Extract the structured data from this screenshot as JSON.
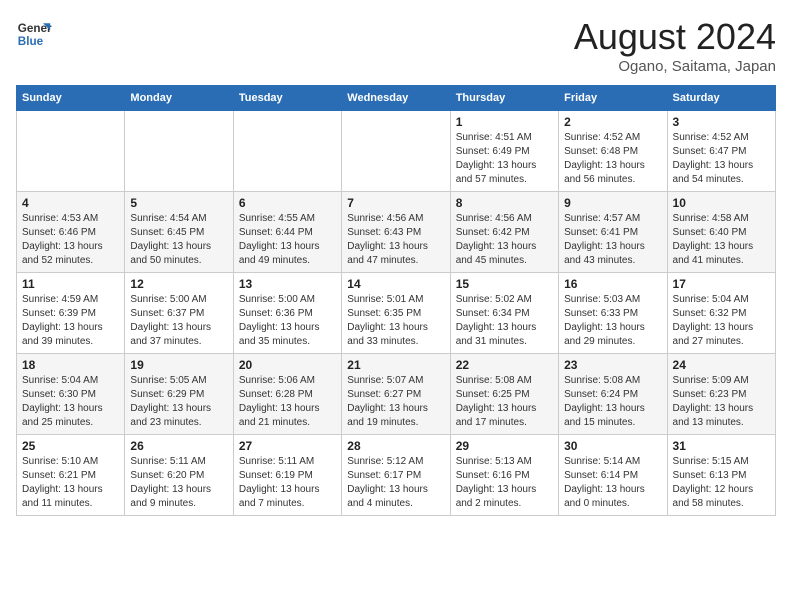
{
  "header": {
    "logo_line1": "General",
    "logo_line2": "Blue",
    "month": "August 2024",
    "location": "Ogano, Saitama, Japan"
  },
  "weekdays": [
    "Sunday",
    "Monday",
    "Tuesday",
    "Wednesday",
    "Thursday",
    "Friday",
    "Saturday"
  ],
  "rows": [
    [
      {
        "day": "",
        "info": ""
      },
      {
        "day": "",
        "info": ""
      },
      {
        "day": "",
        "info": ""
      },
      {
        "day": "",
        "info": ""
      },
      {
        "day": "1",
        "info": "Sunrise: 4:51 AM\nSunset: 6:49 PM\nDaylight: 13 hours\nand 57 minutes."
      },
      {
        "day": "2",
        "info": "Sunrise: 4:52 AM\nSunset: 6:48 PM\nDaylight: 13 hours\nand 56 minutes."
      },
      {
        "day": "3",
        "info": "Sunrise: 4:52 AM\nSunset: 6:47 PM\nDaylight: 13 hours\nand 54 minutes."
      }
    ],
    [
      {
        "day": "4",
        "info": "Sunrise: 4:53 AM\nSunset: 6:46 PM\nDaylight: 13 hours\nand 52 minutes."
      },
      {
        "day": "5",
        "info": "Sunrise: 4:54 AM\nSunset: 6:45 PM\nDaylight: 13 hours\nand 50 minutes."
      },
      {
        "day": "6",
        "info": "Sunrise: 4:55 AM\nSunset: 6:44 PM\nDaylight: 13 hours\nand 49 minutes."
      },
      {
        "day": "7",
        "info": "Sunrise: 4:56 AM\nSunset: 6:43 PM\nDaylight: 13 hours\nand 47 minutes."
      },
      {
        "day": "8",
        "info": "Sunrise: 4:56 AM\nSunset: 6:42 PM\nDaylight: 13 hours\nand 45 minutes."
      },
      {
        "day": "9",
        "info": "Sunrise: 4:57 AM\nSunset: 6:41 PM\nDaylight: 13 hours\nand 43 minutes."
      },
      {
        "day": "10",
        "info": "Sunrise: 4:58 AM\nSunset: 6:40 PM\nDaylight: 13 hours\nand 41 minutes."
      }
    ],
    [
      {
        "day": "11",
        "info": "Sunrise: 4:59 AM\nSunset: 6:39 PM\nDaylight: 13 hours\nand 39 minutes."
      },
      {
        "day": "12",
        "info": "Sunrise: 5:00 AM\nSunset: 6:37 PM\nDaylight: 13 hours\nand 37 minutes."
      },
      {
        "day": "13",
        "info": "Sunrise: 5:00 AM\nSunset: 6:36 PM\nDaylight: 13 hours\nand 35 minutes."
      },
      {
        "day": "14",
        "info": "Sunrise: 5:01 AM\nSunset: 6:35 PM\nDaylight: 13 hours\nand 33 minutes."
      },
      {
        "day": "15",
        "info": "Sunrise: 5:02 AM\nSunset: 6:34 PM\nDaylight: 13 hours\nand 31 minutes."
      },
      {
        "day": "16",
        "info": "Sunrise: 5:03 AM\nSunset: 6:33 PM\nDaylight: 13 hours\nand 29 minutes."
      },
      {
        "day": "17",
        "info": "Sunrise: 5:04 AM\nSunset: 6:32 PM\nDaylight: 13 hours\nand 27 minutes."
      }
    ],
    [
      {
        "day": "18",
        "info": "Sunrise: 5:04 AM\nSunset: 6:30 PM\nDaylight: 13 hours\nand 25 minutes."
      },
      {
        "day": "19",
        "info": "Sunrise: 5:05 AM\nSunset: 6:29 PM\nDaylight: 13 hours\nand 23 minutes."
      },
      {
        "day": "20",
        "info": "Sunrise: 5:06 AM\nSunset: 6:28 PM\nDaylight: 13 hours\nand 21 minutes."
      },
      {
        "day": "21",
        "info": "Sunrise: 5:07 AM\nSunset: 6:27 PM\nDaylight: 13 hours\nand 19 minutes."
      },
      {
        "day": "22",
        "info": "Sunrise: 5:08 AM\nSunset: 6:25 PM\nDaylight: 13 hours\nand 17 minutes."
      },
      {
        "day": "23",
        "info": "Sunrise: 5:08 AM\nSunset: 6:24 PM\nDaylight: 13 hours\nand 15 minutes."
      },
      {
        "day": "24",
        "info": "Sunrise: 5:09 AM\nSunset: 6:23 PM\nDaylight: 13 hours\nand 13 minutes."
      }
    ],
    [
      {
        "day": "25",
        "info": "Sunrise: 5:10 AM\nSunset: 6:21 PM\nDaylight: 13 hours\nand 11 minutes."
      },
      {
        "day": "26",
        "info": "Sunrise: 5:11 AM\nSunset: 6:20 PM\nDaylight: 13 hours\nand 9 minutes."
      },
      {
        "day": "27",
        "info": "Sunrise: 5:11 AM\nSunset: 6:19 PM\nDaylight: 13 hours\nand 7 minutes."
      },
      {
        "day": "28",
        "info": "Sunrise: 5:12 AM\nSunset: 6:17 PM\nDaylight: 13 hours\nand 4 minutes."
      },
      {
        "day": "29",
        "info": "Sunrise: 5:13 AM\nSunset: 6:16 PM\nDaylight: 13 hours\nand 2 minutes."
      },
      {
        "day": "30",
        "info": "Sunrise: 5:14 AM\nSunset: 6:14 PM\nDaylight: 13 hours\nand 0 minutes."
      },
      {
        "day": "31",
        "info": "Sunrise: 5:15 AM\nSunset: 6:13 PM\nDaylight: 12 hours\nand 58 minutes."
      }
    ]
  ]
}
